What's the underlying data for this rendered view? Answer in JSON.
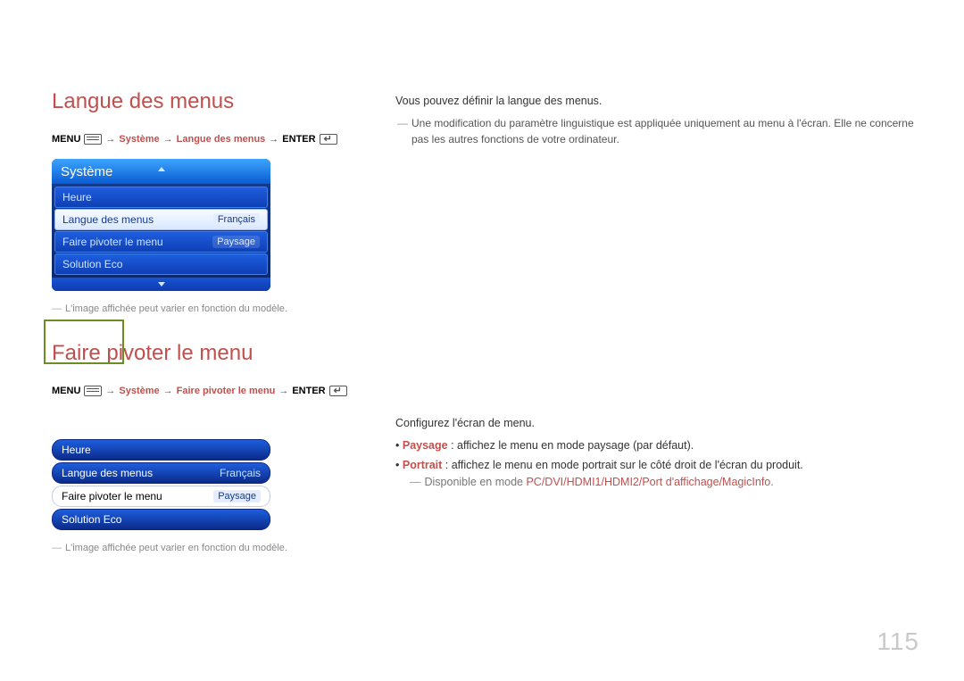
{
  "section1": {
    "title": "Langue des menus",
    "breadcrumb": {
      "menu": "MENU",
      "step1": "Système",
      "step2": "Langue des menus",
      "enter": "ENTER"
    },
    "osd": {
      "header": "Système",
      "rows": [
        {
          "label": "Heure",
          "value": ""
        },
        {
          "label": "Langue des menus",
          "value": "Français",
          "selected": true
        },
        {
          "label": "Faire pivoter le menu",
          "value": "Paysage"
        },
        {
          "label": "Solution Eco",
          "value": ""
        }
      ]
    },
    "footnote": "L'image affichée peut varier en fonction du modèle.",
    "desc_intro": "Vous pouvez définir la langue des menus.",
    "desc_note": "Une modification du paramètre linguistique est appliquée uniquement au menu à l'écran. Elle ne concerne pas les autres fonctions de votre ordinateur."
  },
  "section2": {
    "title": "Faire pivoter le menu",
    "breadcrumb": {
      "menu": "MENU",
      "step1": "Système",
      "step2": "Faire pivoter le menu",
      "enter": "ENTER"
    },
    "osd": {
      "rows": [
        {
          "label": "Heure",
          "value": ""
        },
        {
          "label": "Langue des menus",
          "value": "Français"
        },
        {
          "label": "Faire pivoter le menu",
          "value": "Paysage",
          "selected": true
        },
        {
          "label": "Solution Eco",
          "value": ""
        }
      ]
    },
    "footnote": "L'image affichée peut varier en fonction du modèle.",
    "desc_intro": "Configurez l'écran de menu.",
    "bullets": [
      {
        "kw": "Paysage",
        "text": " : affichez le menu en mode paysage (par défaut)."
      },
      {
        "kw": "Portrait",
        "text": " : affichez le menu en mode portrait sur le côté droit de l'écran du produit."
      }
    ],
    "available_pre": "Disponible en mode ",
    "available_modes": "PC/DVI/HDMI1/HDMI2/Port d'affichage/MagicInfo",
    "available_post": "."
  },
  "page_number": "115"
}
